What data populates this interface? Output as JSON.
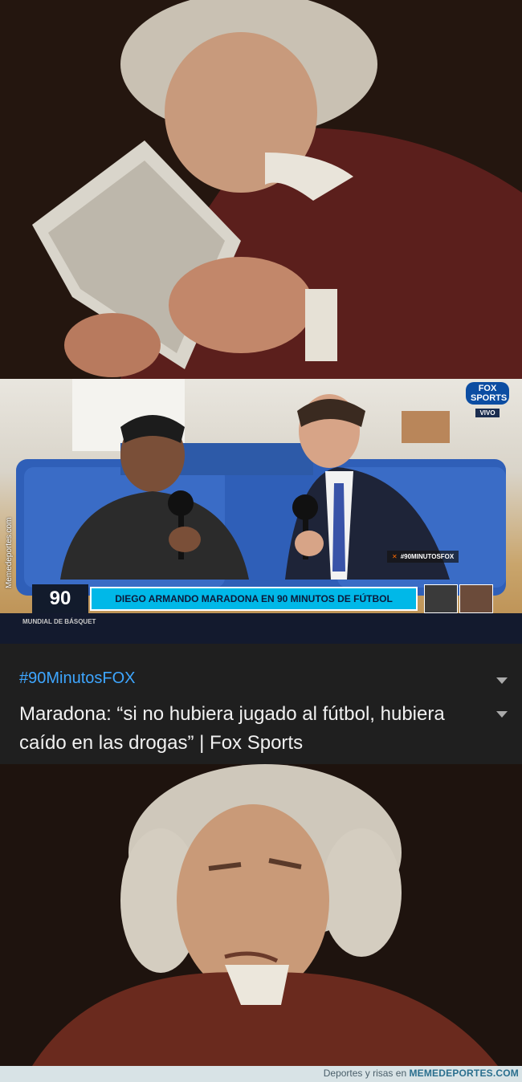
{
  "video": {
    "channel_logo": "FOX SPORTS",
    "live_badge": "VIVO",
    "hashtag_chip": "#90MINUTOSFOX",
    "show_logo": "90",
    "banner_text": "DIEGO ARMANDO MARADONA EN 90 MINUTOS DE FÚTBOL",
    "ticker_label": "MUNDIAL DE BÁSQUET",
    "side_watermark": "Memedeportes.com"
  },
  "card": {
    "hashtag": "#90MinutosFOX",
    "title": "Maradona: “si no hubiera jugado al fútbol, hubiera caído en las drogas” | Fox Sports"
  },
  "footer": {
    "prefix": "Deportes y risas en ",
    "site": "MEMEDEPORTES.COM"
  },
  "colors": {
    "hashtag_link": "#3ea6ff",
    "banner": "#00b8e8",
    "card_background": "#1f1f1f"
  }
}
